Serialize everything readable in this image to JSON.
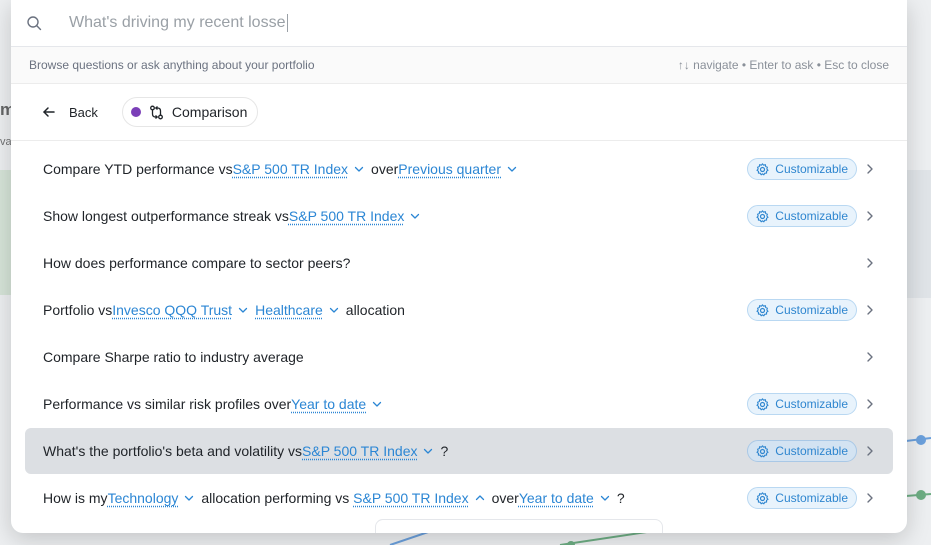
{
  "background": {
    "left_heading": "m",
    "left_sub": "va"
  },
  "search": {
    "value": "What's driving my recent losse",
    "icon": "search-icon"
  },
  "hints": {
    "left": "Browse questions or ask anything about your portfolio",
    "right": "↑↓ navigate • Enter to ask • Esc to close"
  },
  "nav": {
    "back_label": "Back",
    "category_label": "Comparison",
    "category_color": "#7b3fb8"
  },
  "badge_label": "Customizable",
  "colors": {
    "accent": "#2b86d4",
    "badge_bg": "#e8f3fc",
    "active_row": "#dcdfe3"
  },
  "rows": [
    {
      "parts": [
        {
          "t": "text",
          "v": "Compare YTD performance vs"
        },
        {
          "t": "param",
          "v": "S&P 500 TR Index"
        },
        {
          "t": "text",
          "v": "over"
        },
        {
          "t": "param",
          "v": "Previous quarter"
        }
      ],
      "customizable": true
    },
    {
      "parts": [
        {
          "t": "text",
          "v": "Show longest outperformance streak vs"
        },
        {
          "t": "param",
          "v": "S&P 500 TR Index"
        }
      ],
      "customizable": true
    },
    {
      "parts": [
        {
          "t": "text",
          "v": "How does performance compare to sector peers?"
        }
      ],
      "customizable": false
    },
    {
      "parts": [
        {
          "t": "text",
          "v": "Portfolio vs"
        },
        {
          "t": "param",
          "v": "Invesco QQQ Trust"
        },
        {
          "t": "param",
          "v": "Healthcare"
        },
        {
          "t": "text",
          "v": "allocation"
        }
      ],
      "customizable": true
    },
    {
      "parts": [
        {
          "t": "text",
          "v": "Compare Sharpe ratio to industry average"
        }
      ],
      "customizable": false
    },
    {
      "parts": [
        {
          "t": "text",
          "v": "Performance vs similar risk profiles over"
        },
        {
          "t": "param",
          "v": "Year to date"
        }
      ],
      "customizable": true
    },
    {
      "parts": [
        {
          "t": "text",
          "v": "What's the portfolio's beta and volatility vs"
        },
        {
          "t": "param",
          "v": "S&P 500 TR Index"
        },
        {
          "t": "text",
          "v": "?"
        }
      ],
      "customizable": true,
      "active": true
    },
    {
      "parts": [
        {
          "t": "text",
          "v": "How is my"
        },
        {
          "t": "param",
          "v": "Technology"
        },
        {
          "t": "text",
          "v": "allocation performing vs "
        },
        {
          "t": "param",
          "v": "S&P 500 TR Index",
          "open": true
        },
        {
          "t": "text",
          "v": "over"
        },
        {
          "t": "param",
          "v": "Year to date"
        },
        {
          "t": "text",
          "v": "?"
        }
      ],
      "customizable": true
    }
  ]
}
